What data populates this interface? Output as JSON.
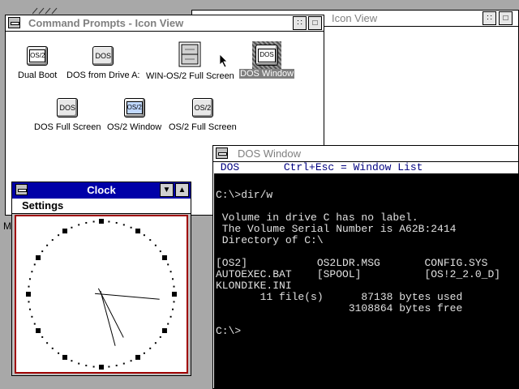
{
  "windows": {
    "command_prompts": {
      "title": "Command Prompts - Icon View",
      "icons": [
        {
          "label": "Dual Boot",
          "glyph": "OS/2"
        },
        {
          "label": "DOS from Drive A:",
          "glyph": "DOS"
        },
        {
          "label": "WIN-OS/2 Full Screen",
          "glyph": ""
        },
        {
          "label": "DOS Window",
          "glyph": "DOS"
        },
        {
          "label": "DOS Full Screen",
          "glyph": "DOS"
        },
        {
          "label": "OS/2 Window",
          "glyph": "OS/2"
        },
        {
          "label": "OS/2 Full Screen",
          "glyph": "OS/2"
        }
      ]
    },
    "icon_view_bg": {
      "title": "Icon View"
    },
    "clock": {
      "title": "Clock",
      "menu_settings": "Settings",
      "hands": {
        "hour_deg": 153,
        "minute_deg": 95,
        "second_deg": 165
      }
    },
    "dos_window": {
      "title": "DOS Window",
      "menu_line": " DOS       Ctrl+Esc = Window List",
      "console_lines": [
        "",
        "C:\\>dir/w",
        "",
        " Volume in drive C has no label.",
        " The Volume Serial Number is A62B:2414",
        " Directory of C:\\",
        "",
        "[OS2]           OS2LDR.MSG       CONFIG.SYS",
        "AUTOEXEC.BAT    [SPOOL]          [OS!2_2.0_D]",
        "KLONDIKE.INI",
        "       11 file(s)      87138 bytes used",
        "                     3108864 bytes free",
        "",
        "C:\\>"
      ]
    }
  },
  "desktop_fragment": "M"
}
